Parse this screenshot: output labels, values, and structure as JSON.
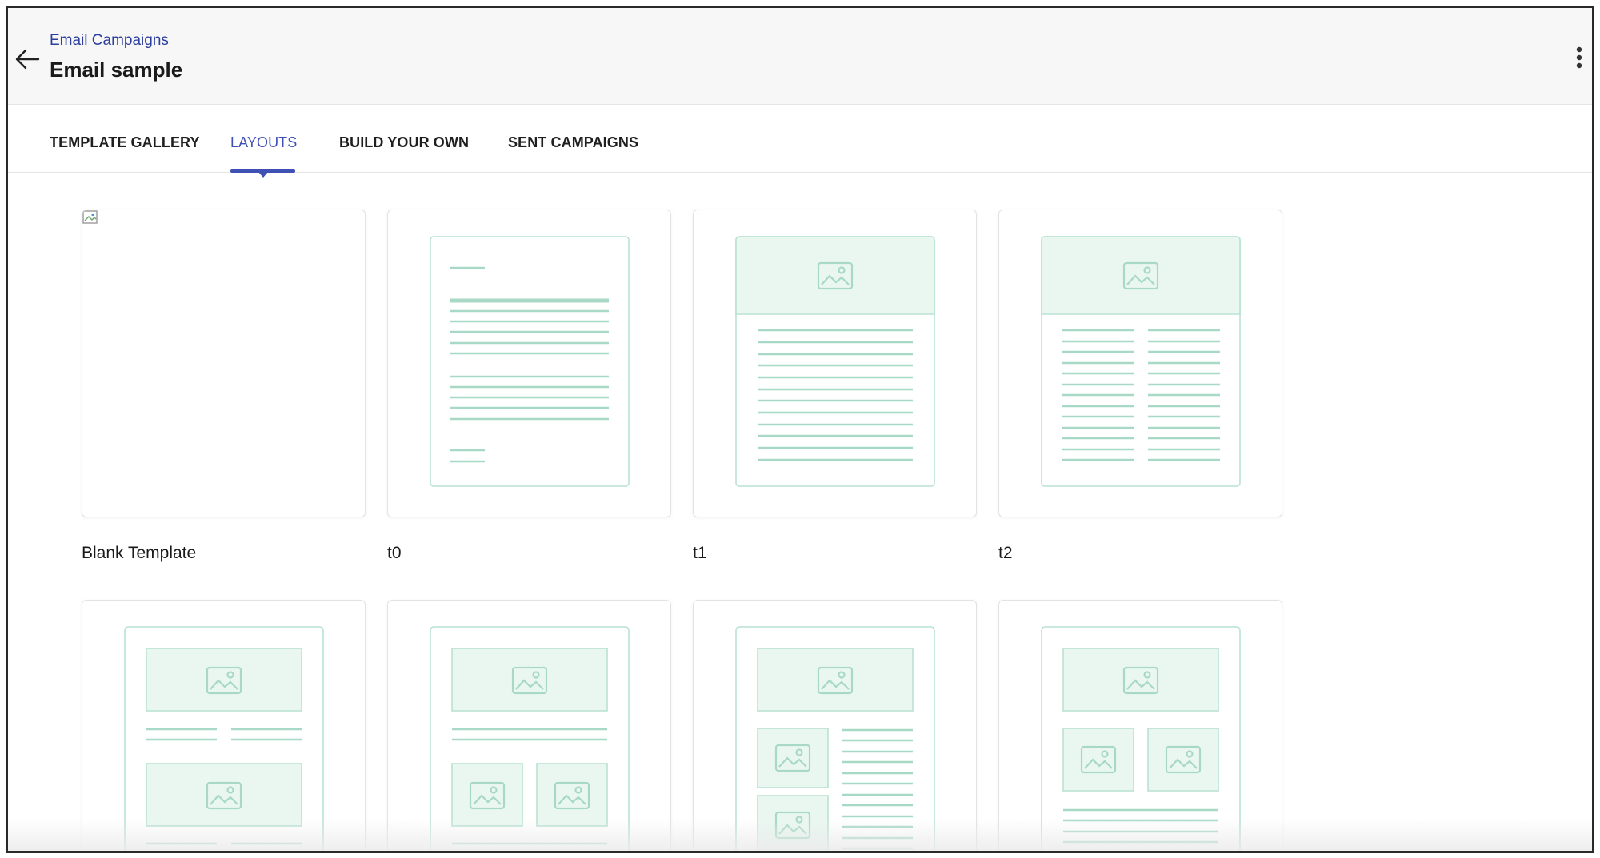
{
  "header": {
    "breadcrumb": "Email Campaigns",
    "title": "Email sample"
  },
  "tabs": [
    {
      "label": "TEMPLATE GALLERY",
      "active": false
    },
    {
      "label": "LAYOUTS",
      "active": true
    },
    {
      "label": "BUILD YOUR OWN",
      "active": false
    },
    {
      "label": "SENT CAMPAIGNS",
      "active": false
    }
  ],
  "layouts": [
    {
      "label": "Blank Template",
      "preview": "blank"
    },
    {
      "label": "t0",
      "preview": "text-only"
    },
    {
      "label": "t1",
      "preview": "header-image-single-column"
    },
    {
      "label": "t2",
      "preview": "header-image-two-columns"
    },
    {
      "label": "",
      "preview": "two-image-sections-two-columns"
    },
    {
      "label": "",
      "preview": "image-text-two-images"
    },
    {
      "label": "",
      "preview": "image-stacked-images-text"
    },
    {
      "label": "",
      "preview": "image-two-images-text"
    }
  ],
  "colors": {
    "accent": "#3f51b5",
    "breadcrumb": "#2c3e9e",
    "preview_line": "#a8d9c6",
    "preview_fill": "#eaf7f1",
    "preview_border": "#b9e2d2"
  },
  "icons": {
    "back": "arrow-left-icon",
    "more": "more-vertical-icon",
    "image_placeholder": "image-icon"
  }
}
